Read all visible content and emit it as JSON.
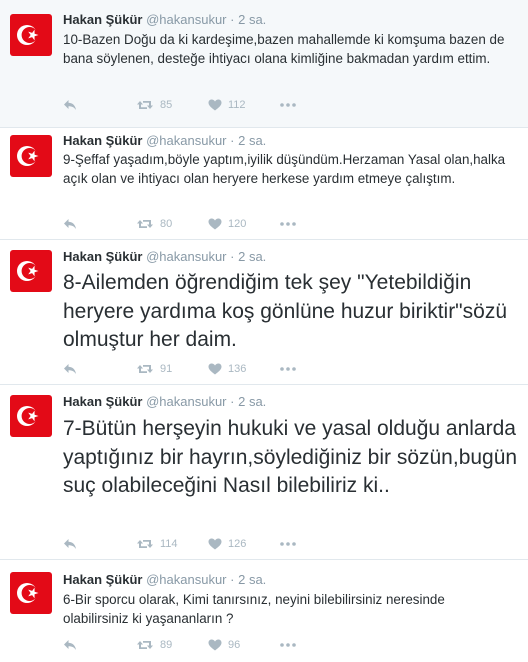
{
  "tweets": [
    {
      "name": "Hakan Şükür",
      "handle": "@hakansukur",
      "dot": "·",
      "time": "2 sa.",
      "text": "10-Bazen Doğu da ki kardeşime,bazen mahallemde ki komşuma bazen de bana söylenen, desteğe ihtiyacı olana kimliğine bakmadan yardım ettim.",
      "retweets": "85",
      "likes": "112"
    },
    {
      "name": "Hakan Şükür",
      "handle": "@hakansukur",
      "dot": "·",
      "time": "2 sa.",
      "text": "9-Şeffaf yaşadım,böyle yaptım,iyilik düşündüm.Herzaman Yasal olan,halka açık olan ve ihtiyacı olan heryere herkese yardım etmeye çalıştım.",
      "retweets": "80",
      "likes": "120"
    },
    {
      "name": "Hakan Şükür",
      "handle": "@hakansukur",
      "dot": "·",
      "time": "2 sa.",
      "text": "8-Ailemden öğrendiğim tek şey \"Yetebildiğin heryere yardıma koş gönlüne huzur biriktir\"sözü olmuştur her daim.",
      "retweets": "91",
      "likes": "136"
    },
    {
      "name": "Hakan Şükür",
      "handle": "@hakansukur",
      "dot": "·",
      "time": "2 sa.",
      "text": "7-Bütün herşeyin hukuki ve yasal olduğu anlarda yaptığınız bir hayrın,söylediğiniz bir sözün,bugün suç olabileceğini Nasıl bilebiliriz ki..",
      "retweets": "114",
      "likes": "126"
    },
    {
      "name": "Hakan Şükür",
      "handle": "@hakansukur",
      "dot": "·",
      "time": "2 sa.",
      "text": "6-Bir sporcu olarak, Kimi tanırsınız, neyini bilebilirsiniz neresinde olabilirsiniz ki yaşananların ?",
      "retweets": "89",
      "likes": "96"
    }
  ],
  "icons": {
    "avatar": "turkish-flag",
    "reply": "reply-icon",
    "retweet": "retweet-icon",
    "like": "heart-icon",
    "more": "more-icon"
  },
  "colors": {
    "flag_red": "#e30a17",
    "icon_gray": "#aab8c2",
    "meta_gray": "#8899a6",
    "highlight_bg": "#f5f8fa"
  }
}
